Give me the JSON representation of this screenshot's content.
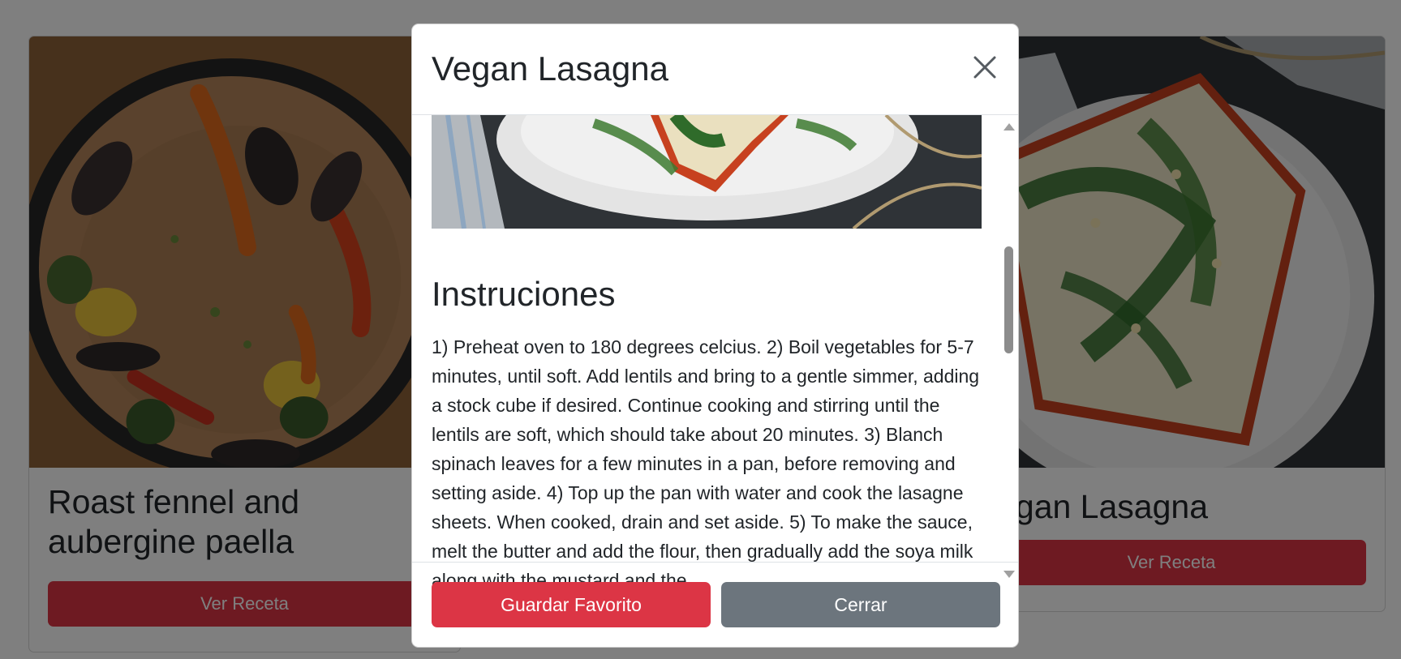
{
  "cards": [
    {
      "title": "Roast fennel and aubergine paella",
      "button_label": "Ver Receta",
      "image": "paella-pan-photo"
    },
    {
      "title": "Vegan Lasagna",
      "button_label": "Ver Receta",
      "image": "lasagna-plate-photo"
    }
  ],
  "modal": {
    "title": "Vegan Lasagna",
    "close_icon": "close-icon",
    "image": "lasagna-plate-photo",
    "section_title": "Instruciones",
    "instructions": "1) Preheat oven to 180 degrees celcius. 2) Boil vegetables for 5-7 minutes, until soft. Add lentils and bring to a gentle simmer, adding a stock cube if desired. Continue cooking and stirring until the lentils are soft, which should take about 20 minutes. 3) Blanch spinach leaves for a few minutes in a pan, before removing and setting aside. 4) Top up the pan with water and cook the lasagne sheets. When cooked, drain and set aside. 5) To make the sauce, melt the butter and add the flour, then gradually add the soya milk along with the mustard and the",
    "buttons": {
      "favorite_label": "Guardar Favorito",
      "close_label": "Cerrar"
    }
  },
  "colors": {
    "primary": "#dc3545",
    "secondary": "#6c757d",
    "backdrop": "rgba(0,0,0,0.5)"
  }
}
